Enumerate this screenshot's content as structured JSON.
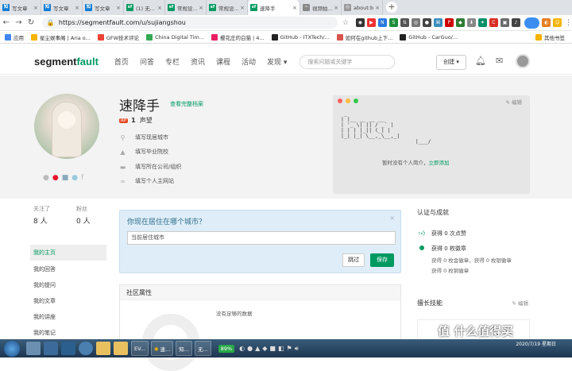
{
  "browser": {
    "tabs": [
      {
        "icon": "知",
        "label": "写文章",
        "color": "#0e7dd6"
      },
      {
        "icon": "知",
        "label": "写文章",
        "color": "#0e7dd6"
      },
      {
        "icon": "知",
        "label": "写文章",
        "color": "#0e7dd6"
      },
      {
        "icon": "sf",
        "label": "(1) 无...",
        "color": "#009a61"
      },
      {
        "icon": "sf",
        "label": "常规设...",
        "color": "#009a61"
      },
      {
        "icon": "sf",
        "label": "常规设...",
        "color": "#009a61"
      },
      {
        "icon": "sf",
        "label": "速降手",
        "color": "#009a61",
        "active": true
      },
      {
        "icon": "~",
        "label": "视频拍...",
        "color": "#888"
      },
      {
        "icon": "◎",
        "label": "about:b",
        "color": "#999"
      }
    ],
    "url": "https://segmentfault.com/u/sujiangshou",
    "bookmarks": [
      {
        "label": "应用",
        "color": "#4285f4"
      },
      {
        "label": "星尘娱事阁 | Aria o...",
        "color": "#f4b400"
      },
      {
        "label": "GFW技术评论",
        "color": "#ea4335"
      },
      {
        "label": "China Digital Tim...",
        "color": "#34a853"
      },
      {
        "label": "樱花庄的白猫 | 4...",
        "color": "#e91e63"
      },
      {
        "label": "GitHub - ITXTech/...",
        "color": "#222"
      },
      {
        "label": "如何在github上下...",
        "color": "#d9534f"
      },
      {
        "label": "GitHub - CarGuo/...",
        "color": "#222"
      },
      {
        "label": "其他书签",
        "color": "#f4b400"
      }
    ]
  },
  "site": {
    "logo_prefix": "segment",
    "logo_suffix": "fault",
    "nav": [
      "首页",
      "问答",
      "专栏",
      "资讯",
      "课程",
      "活动",
      "发现 ▾"
    ],
    "search_placeholder": "搜索问题或关键字",
    "create_label": "创建 ▾"
  },
  "profile": {
    "name": "速降手",
    "archive_link": "查看完整档案",
    "rep_badge": "RP",
    "rep_value": "1",
    "rep_label": "声望",
    "fields": [
      "填写现居城市",
      "填写毕业院校",
      "填写所在公司/组织",
      "填写个人主网站"
    ],
    "card_edit": "编辑",
    "intro": "暂时没有个人简介，",
    "intro_link": "立即添加"
  },
  "stats": {
    "following_label": "关注了",
    "following_value": "8 人",
    "fans_label": "粉丝",
    "fans_value": "0 人"
  },
  "sidenav": [
    "我的主页",
    "我的回答",
    "我的提问",
    "我的文章",
    "我的讲座",
    "我的笔记"
  ],
  "city_prompt": {
    "question": "你现在居住在哪个城市？",
    "placeholder": "当前居住城市",
    "skip": "跳过",
    "save": "保存"
  },
  "community": {
    "title": "社区属性",
    "empty": "没有足够的数据"
  },
  "achievements": {
    "title": "认证与成就",
    "likes": "获得 0 次点赞",
    "badges": "获得 0 枚徽章",
    "gold_silver": "获得 0 枚金徽章，获得 0 枚银徽章",
    "bronze": "获得 0 枚铜徽章"
  },
  "skills": {
    "title": "擅长技能",
    "edit": "编辑"
  },
  "taskbar": {
    "buttons": [
      "EV...",
      "速...",
      "知...",
      "无..."
    ],
    "battery": "89%",
    "time": "2020/7/19 星期日"
  },
  "watermark": "值 什么值得买"
}
